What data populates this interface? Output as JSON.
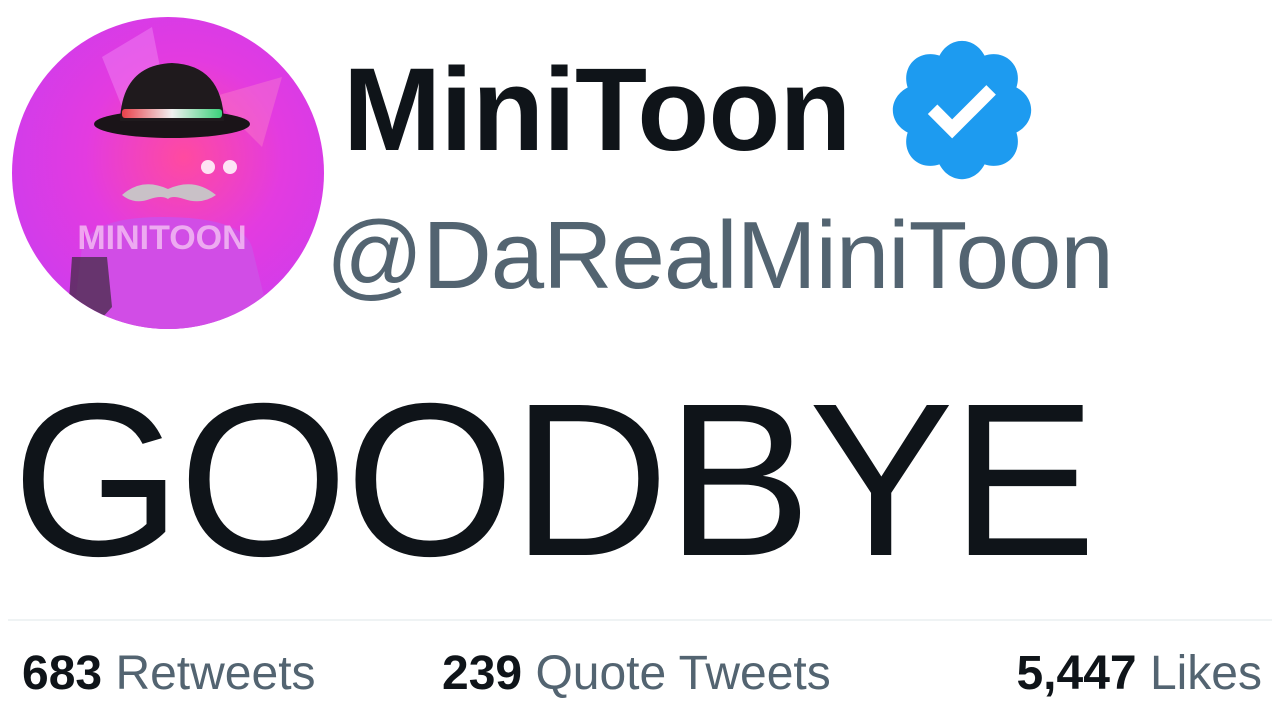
{
  "author": {
    "display_name": "MiniToon",
    "handle": "@DaRealMiniToon",
    "verified": true,
    "avatar_text": "MINITOON"
  },
  "tweet": {
    "text": "GOODBYE"
  },
  "stats": {
    "retweets": {
      "count": "683",
      "label": "Retweets"
    },
    "quote_tweets": {
      "count": "239",
      "label": "Quote Tweets"
    },
    "likes": {
      "count": "5,447",
      "label": "Likes"
    }
  },
  "colors": {
    "text_primary": "#0f1419",
    "text_secondary": "#536471",
    "verified_blue": "#1d9bf0",
    "divider": "#eff3f4",
    "avatar_pink": "#e040e8"
  },
  "icons": {
    "verified": "verified-badge-icon"
  }
}
